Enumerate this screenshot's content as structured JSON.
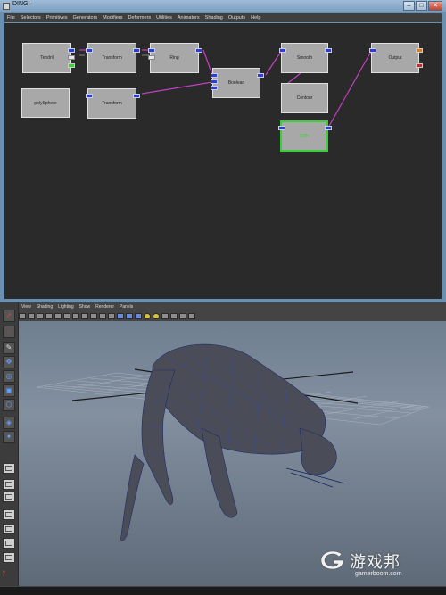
{
  "window1": {
    "title": "DING!",
    "buttons": {
      "minimize": "–",
      "maximize": "□",
      "close": "✕"
    },
    "menu": [
      "File",
      "Selectors",
      "Primitives",
      "Generators",
      "Modifiers",
      "Deformers",
      "Utilities",
      "Animators",
      "Shading",
      "Outputs",
      "Help"
    ]
  },
  "nodes": {
    "tendril": "Tendril",
    "transform1": "Transform",
    "ring": "Ring",
    "polysphere": "polySphere",
    "transform2": "Transform",
    "boolean": "Boolean",
    "smooth": "Smooth",
    "contour": "Contour",
    "selected": "GRN",
    "output": "Output"
  },
  "window2": {
    "panel_menu": [
      "View",
      "Shading",
      "Lighting",
      "Show",
      "Renderer",
      "Panels"
    ],
    "axis": "y",
    "tools": [
      "select-tool",
      "lasso-tool",
      "paint-tool",
      "move-tool",
      "rotate-tool",
      "scale-tool",
      "manipulator-tool",
      "soft-select-tool",
      "last-tool"
    ]
  },
  "watermark": {
    "chinese": "游戏邦",
    "english": "gamerboom.com"
  },
  "colors": {
    "port_blue": "#2a3fd8",
    "wire_magenta": "#c040c0",
    "selected_green": "#3ad03a"
  }
}
